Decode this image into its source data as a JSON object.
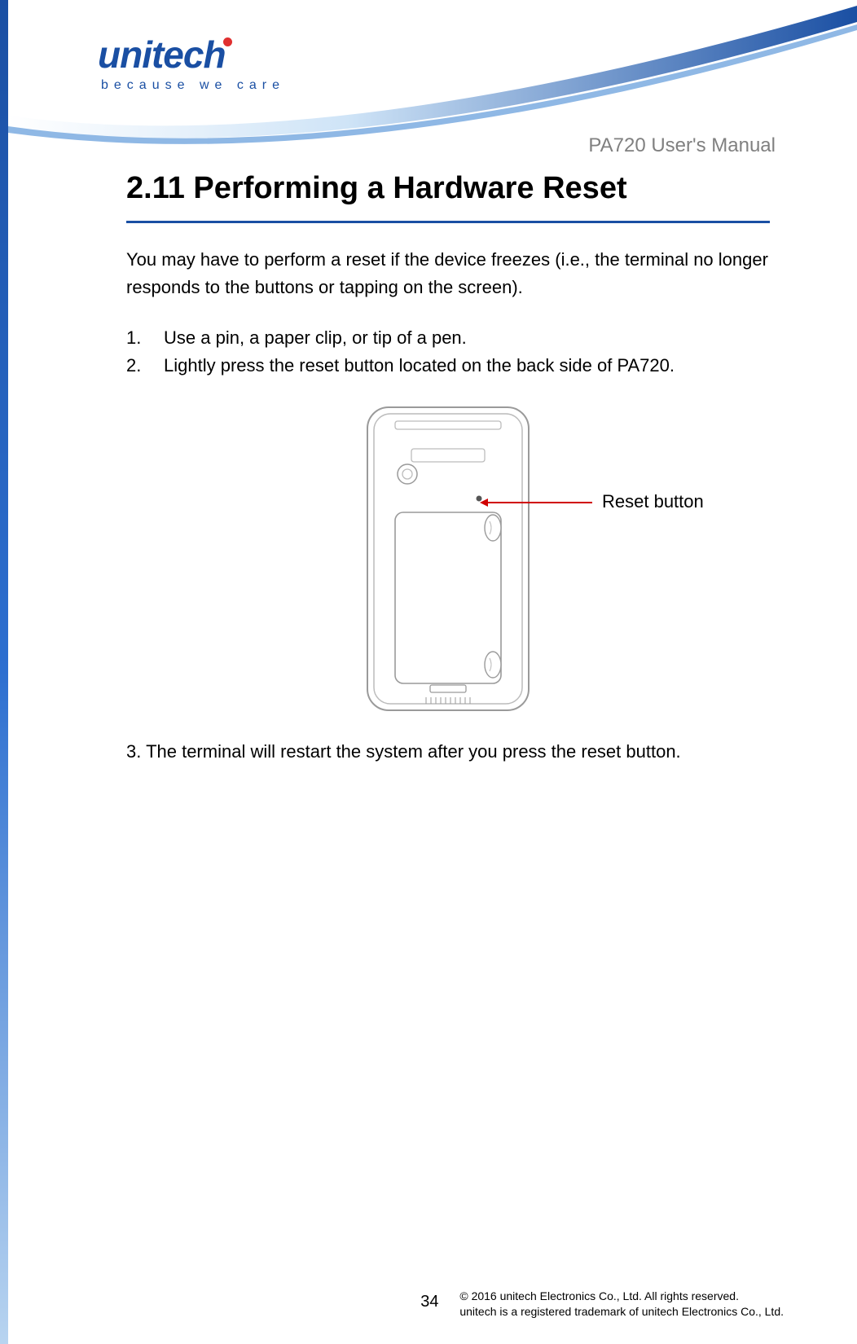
{
  "logo": {
    "name": "unitech",
    "tagline": "because we care"
  },
  "doc_title": "PA720 User's Manual",
  "section": {
    "heading": "2.11 Performing a Hardware Reset",
    "intro": "You may have to perform a reset if the device freezes (i.e., the terminal no longer responds to the buttons or tapping on the screen).",
    "steps": [
      "Use a pin, a paper clip, or tip of a pen.",
      "Lightly press the reset button located on the back side of PA720."
    ],
    "step3": "3. The terminal will restart the system after you press the reset button.",
    "callout": "Reset button"
  },
  "footer": {
    "page": "34",
    "copy1": "© 2016 unitech Electronics Co., Ltd. All rights reserved.",
    "copy2": "unitech is a registered trademark of unitech Electronics Co., Ltd."
  }
}
